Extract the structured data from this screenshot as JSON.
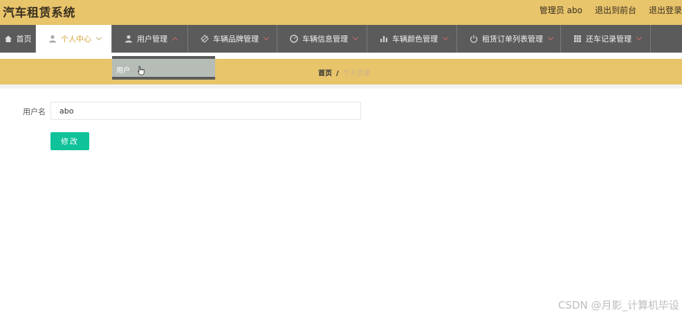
{
  "header": {
    "title": "汽车租赁系统",
    "links": [
      "管理员 abo",
      "退出到前台",
      "退出登录"
    ]
  },
  "nav": {
    "items": [
      {
        "label": "首页",
        "icon": "home-icon"
      },
      {
        "label": "个人中心",
        "icon": "user-icon"
      },
      {
        "label": "用户管理",
        "icon": "user-icon"
      },
      {
        "label": "车辆品牌管理",
        "icon": "tag-icon"
      },
      {
        "label": "车辆信息管理",
        "icon": "gauge-icon"
      },
      {
        "label": "车辆颜色管理",
        "icon": "bar-chart-icon"
      },
      {
        "label": "租赁订单列表管理",
        "icon": "power-icon"
      },
      {
        "label": "还车记录管理",
        "icon": "grid-icon"
      }
    ],
    "dropdown_item": "用户"
  },
  "breadcrumb": {
    "home": "首页",
    "separator": "/",
    "current": "个人信息"
  },
  "form": {
    "username_label": "用户名",
    "username_value": "abo",
    "submit_label": "修改"
  },
  "watermark": "CSDN @月影_计算机毕设",
  "colors": {
    "header_bg": "#e8c46b",
    "nav_bg": "#5b5b5b",
    "active_nav_text": "#d4a73a",
    "button": "#0fc29a"
  }
}
